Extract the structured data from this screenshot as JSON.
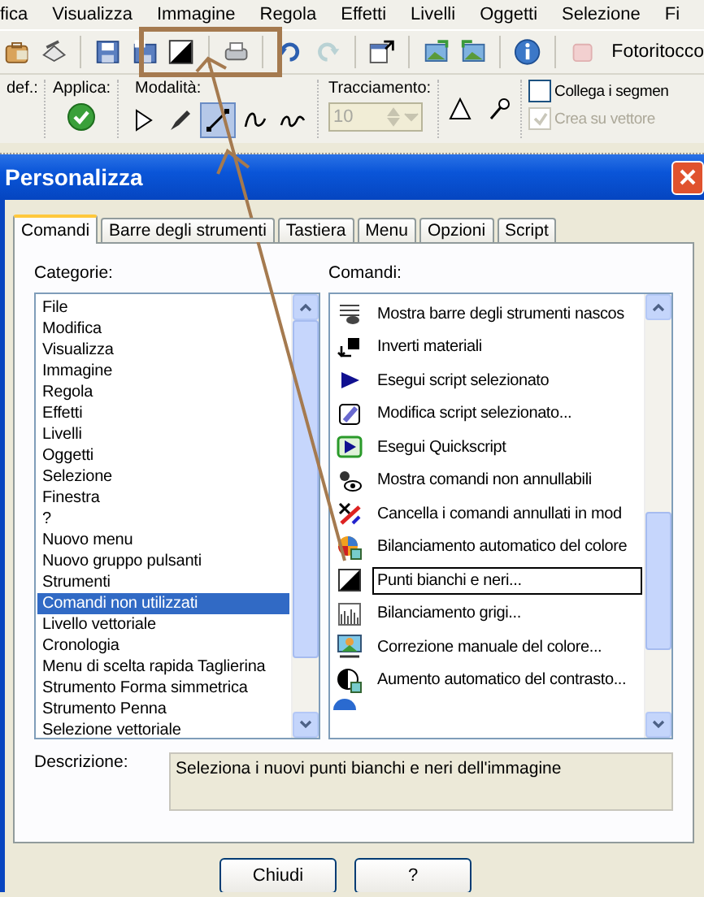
{
  "menu": [
    "fica",
    "Visualizza",
    "Immagine",
    "Regola",
    "Effetti",
    "Livelli",
    "Oggetti",
    "Selezione",
    "Fi"
  ],
  "toolbar": {
    "workspace": "Fotoritocco"
  },
  "tool_options": {
    "presets_label": "def.:",
    "apply_label": "Applica:",
    "mode_label": "Modalità:",
    "modes": [
      {
        "selected": false
      },
      {
        "selected": false
      },
      {
        "selected": true
      },
      {
        "selected": false
      },
      {
        "selected": false
      }
    ],
    "tracking_label": "Tracciamento:",
    "tracking_value": "10",
    "checkboxes": [
      {
        "label": "Collega i segmen",
        "checked": false,
        "disabled": false
      },
      {
        "label": "Crea su vettore",
        "checked": true,
        "disabled": true
      }
    ]
  },
  "dialog": {
    "title": "Personalizza",
    "tabs": [
      {
        "label": "Comandi",
        "selected": true
      },
      {
        "label": "Barre degli strumenti",
        "selected": false
      },
      {
        "label": "Tastiera",
        "selected": false
      },
      {
        "label": "Menu",
        "selected": false
      },
      {
        "label": "Opzioni",
        "selected": false
      },
      {
        "label": "Script",
        "selected": false
      }
    ],
    "categories_label": "Categorie:",
    "categories": [
      {
        "label": "File",
        "selected": false
      },
      {
        "label": "Modifica",
        "selected": false
      },
      {
        "label": "Visualizza",
        "selected": false
      },
      {
        "label": "Immagine",
        "selected": false
      },
      {
        "label": "Regola",
        "selected": false
      },
      {
        "label": "Effetti",
        "selected": false
      },
      {
        "label": "Livelli",
        "selected": false
      },
      {
        "label": "Oggetti",
        "selected": false
      },
      {
        "label": "Selezione",
        "selected": false
      },
      {
        "label": "Finestra",
        "selected": false
      },
      {
        "label": "?",
        "selected": false
      },
      {
        "label": "Nuovo menu",
        "selected": false
      },
      {
        "label": "Nuovo gruppo pulsanti",
        "selected": false
      },
      {
        "label": "Strumenti",
        "selected": false
      },
      {
        "label": "Comandi non utilizzati",
        "selected": true
      },
      {
        "label": "Livello vettoriale",
        "selected": false
      },
      {
        "label": "Cronologia",
        "selected": false
      },
      {
        "label": "Menu di scelta rapida Taglierina",
        "selected": false
      },
      {
        "label": "Strumento Forma simmetrica",
        "selected": false
      },
      {
        "label": "Strumento Penna",
        "selected": false
      },
      {
        "label": "Selezione vettoriale",
        "selected": false
      }
    ],
    "commands_label": "Comandi:",
    "commands": [
      {
        "label": "Mostra barre degli strumenti nascos",
        "selected": false
      },
      {
        "label": "Inverti materiali",
        "selected": false
      },
      {
        "label": "Esegui script selezionato",
        "selected": false
      },
      {
        "label": "Modifica script selezionato...",
        "selected": false
      },
      {
        "label": "Esegui Quickscript",
        "selected": false
      },
      {
        "label": "Mostra comandi non annullabili",
        "selected": false
      },
      {
        "label": "Cancella i comandi annullati in mod",
        "selected": false
      },
      {
        "label": "Bilanciamento automatico del colore",
        "selected": false
      },
      {
        "label": "Punti bianchi e neri...",
        "selected": true
      },
      {
        "label": "Bilanciamento grigi...",
        "selected": false
      },
      {
        "label": "Correzione manuale del colore...",
        "selected": false
      },
      {
        "label": "Aumento automatico del contrasto...",
        "selected": false
      }
    ],
    "description_label": "Descrizione:",
    "description": "Seleziona i nuovi punti bianchi e neri dell'immagine",
    "buttons": [
      "Chiudi",
      "?"
    ]
  }
}
